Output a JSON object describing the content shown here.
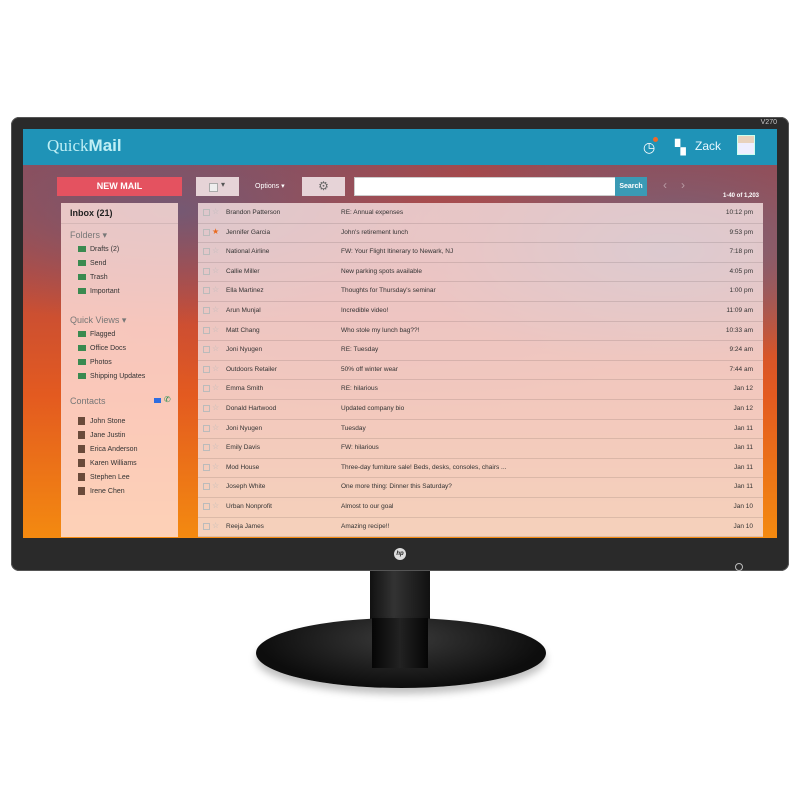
{
  "monitor": {
    "model": "V270",
    "brand": "hp"
  },
  "app": {
    "logo_light": "Quick",
    "logo_bold": "Mail",
    "user": "Zack"
  },
  "toolbar": {
    "new_mail": "NEW MAIL",
    "options": "Options ▾",
    "search_placeholder": "",
    "search_label": "Search",
    "paging": "1-40 of 1,203"
  },
  "sidebar": {
    "inbox": "Inbox (21)",
    "folders_label": "Folders ▾",
    "folders": [
      "Drafts (2)",
      "Send",
      "Trash",
      "Important"
    ],
    "quick_views_label": "Quick Views ▾",
    "quick_views": [
      "Flagged",
      "Office Docs",
      "Photos",
      "Shipping Updates"
    ],
    "contacts_label": "Contacts",
    "contacts": [
      "John Stone",
      "Jane Justin",
      "Erica Anderson",
      "Karen Williams",
      "Stephen Lee",
      "Irene Chen"
    ]
  },
  "emails": [
    {
      "from": "Brandon Patterson",
      "subject": "RE: Annual expenses",
      "time": "10:12 pm",
      "starred": false
    },
    {
      "from": "Jennifer Garcia",
      "subject": "John's retirement lunch",
      "time": "9:53 pm",
      "starred": true
    },
    {
      "from": "National Airline",
      "subject": "FW: Your Flight Itinerary to Newark, NJ",
      "time": "7:18 pm",
      "starred": false
    },
    {
      "from": "Callie Miller",
      "subject": "New parking spots available",
      "time": "4:05 pm",
      "starred": false
    },
    {
      "from": "Ella Martinez",
      "subject": "Thoughts for Thursday's seminar",
      "time": "1:00 pm",
      "starred": false
    },
    {
      "from": "Arun Munjal",
      "subject": "Incredible video!",
      "time": "11:09 am",
      "starred": false
    },
    {
      "from": "Matt Chang",
      "subject": "Who stole my lunch bag??!",
      "time": "10:33 am",
      "starred": false
    },
    {
      "from": "Joni Nyugen",
      "subject": "RE: Tuesday",
      "time": "9:24 am",
      "starred": false
    },
    {
      "from": "Outdoors Retailer",
      "subject": "50% off winter wear",
      "time": "7:44 am",
      "starred": false
    },
    {
      "from": "Emma Smith",
      "subject": "RE: hilarious",
      "time": "Jan 12",
      "starred": false
    },
    {
      "from": "Donald Hartwood",
      "subject": "Updated company bio",
      "time": "Jan 12",
      "starred": false
    },
    {
      "from": "Joni Nyugen",
      "subject": "Tuesday",
      "time": "Jan 11",
      "starred": false
    },
    {
      "from": "Emily Davis",
      "subject": "FW: hilarious",
      "time": "Jan 11",
      "starred": false
    },
    {
      "from": "Mod House",
      "subject": "Three-day furniture sale! Beds, desks, consoles, chairs ...",
      "time": "Jan 11",
      "starred": false
    },
    {
      "from": "Joseph White",
      "subject": "One more thing: Dinner this Saturday?",
      "time": "Jan 11",
      "starred": false
    },
    {
      "from": "Urban Nonprofit",
      "subject": "Almost to our goal",
      "time": "Jan 10",
      "starred": false
    },
    {
      "from": "Reeja James",
      "subject": "Amazing recipe!!",
      "time": "Jan 10",
      "starred": false
    }
  ]
}
